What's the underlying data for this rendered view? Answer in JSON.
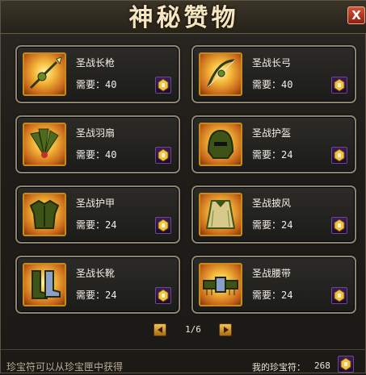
{
  "window": {
    "title": "神秘赞物",
    "close_label": "X"
  },
  "items": [
    {
      "name": "圣战长枪",
      "cost_label": "需要：",
      "cost": "40",
      "icon": "spear-icon"
    },
    {
      "name": "圣战长弓",
      "cost_label": "需要：",
      "cost": "40",
      "icon": "bow-icon"
    },
    {
      "name": "圣战羽扇",
      "cost_label": "需要：",
      "cost": "40",
      "icon": "feather-fan-icon"
    },
    {
      "name": "圣战护盔",
      "cost_label": "需要：",
      "cost": "24",
      "icon": "helmet-icon"
    },
    {
      "name": "圣战护甲",
      "cost_label": "需要：",
      "cost": "24",
      "icon": "armor-icon"
    },
    {
      "name": "圣战披风",
      "cost_label": "需要：",
      "cost": "24",
      "icon": "cloak-icon"
    },
    {
      "name": "圣战长靴",
      "cost_label": "需要：",
      "cost": "24",
      "icon": "boots-icon"
    },
    {
      "name": "圣战腰带",
      "cost_label": "需要：",
      "cost": "24",
      "icon": "belt-icon"
    }
  ],
  "pager": {
    "label": "1/6"
  },
  "footer": {
    "hint": "珍宝符可以从珍宝匣中获得",
    "my_label": "我的珍宝符：",
    "my_value": "268"
  },
  "colors": {
    "card_border": "#8d8470",
    "icon_glow": "#f4b83a",
    "token": "#3a1d5a",
    "title": "#f3e6c2"
  }
}
